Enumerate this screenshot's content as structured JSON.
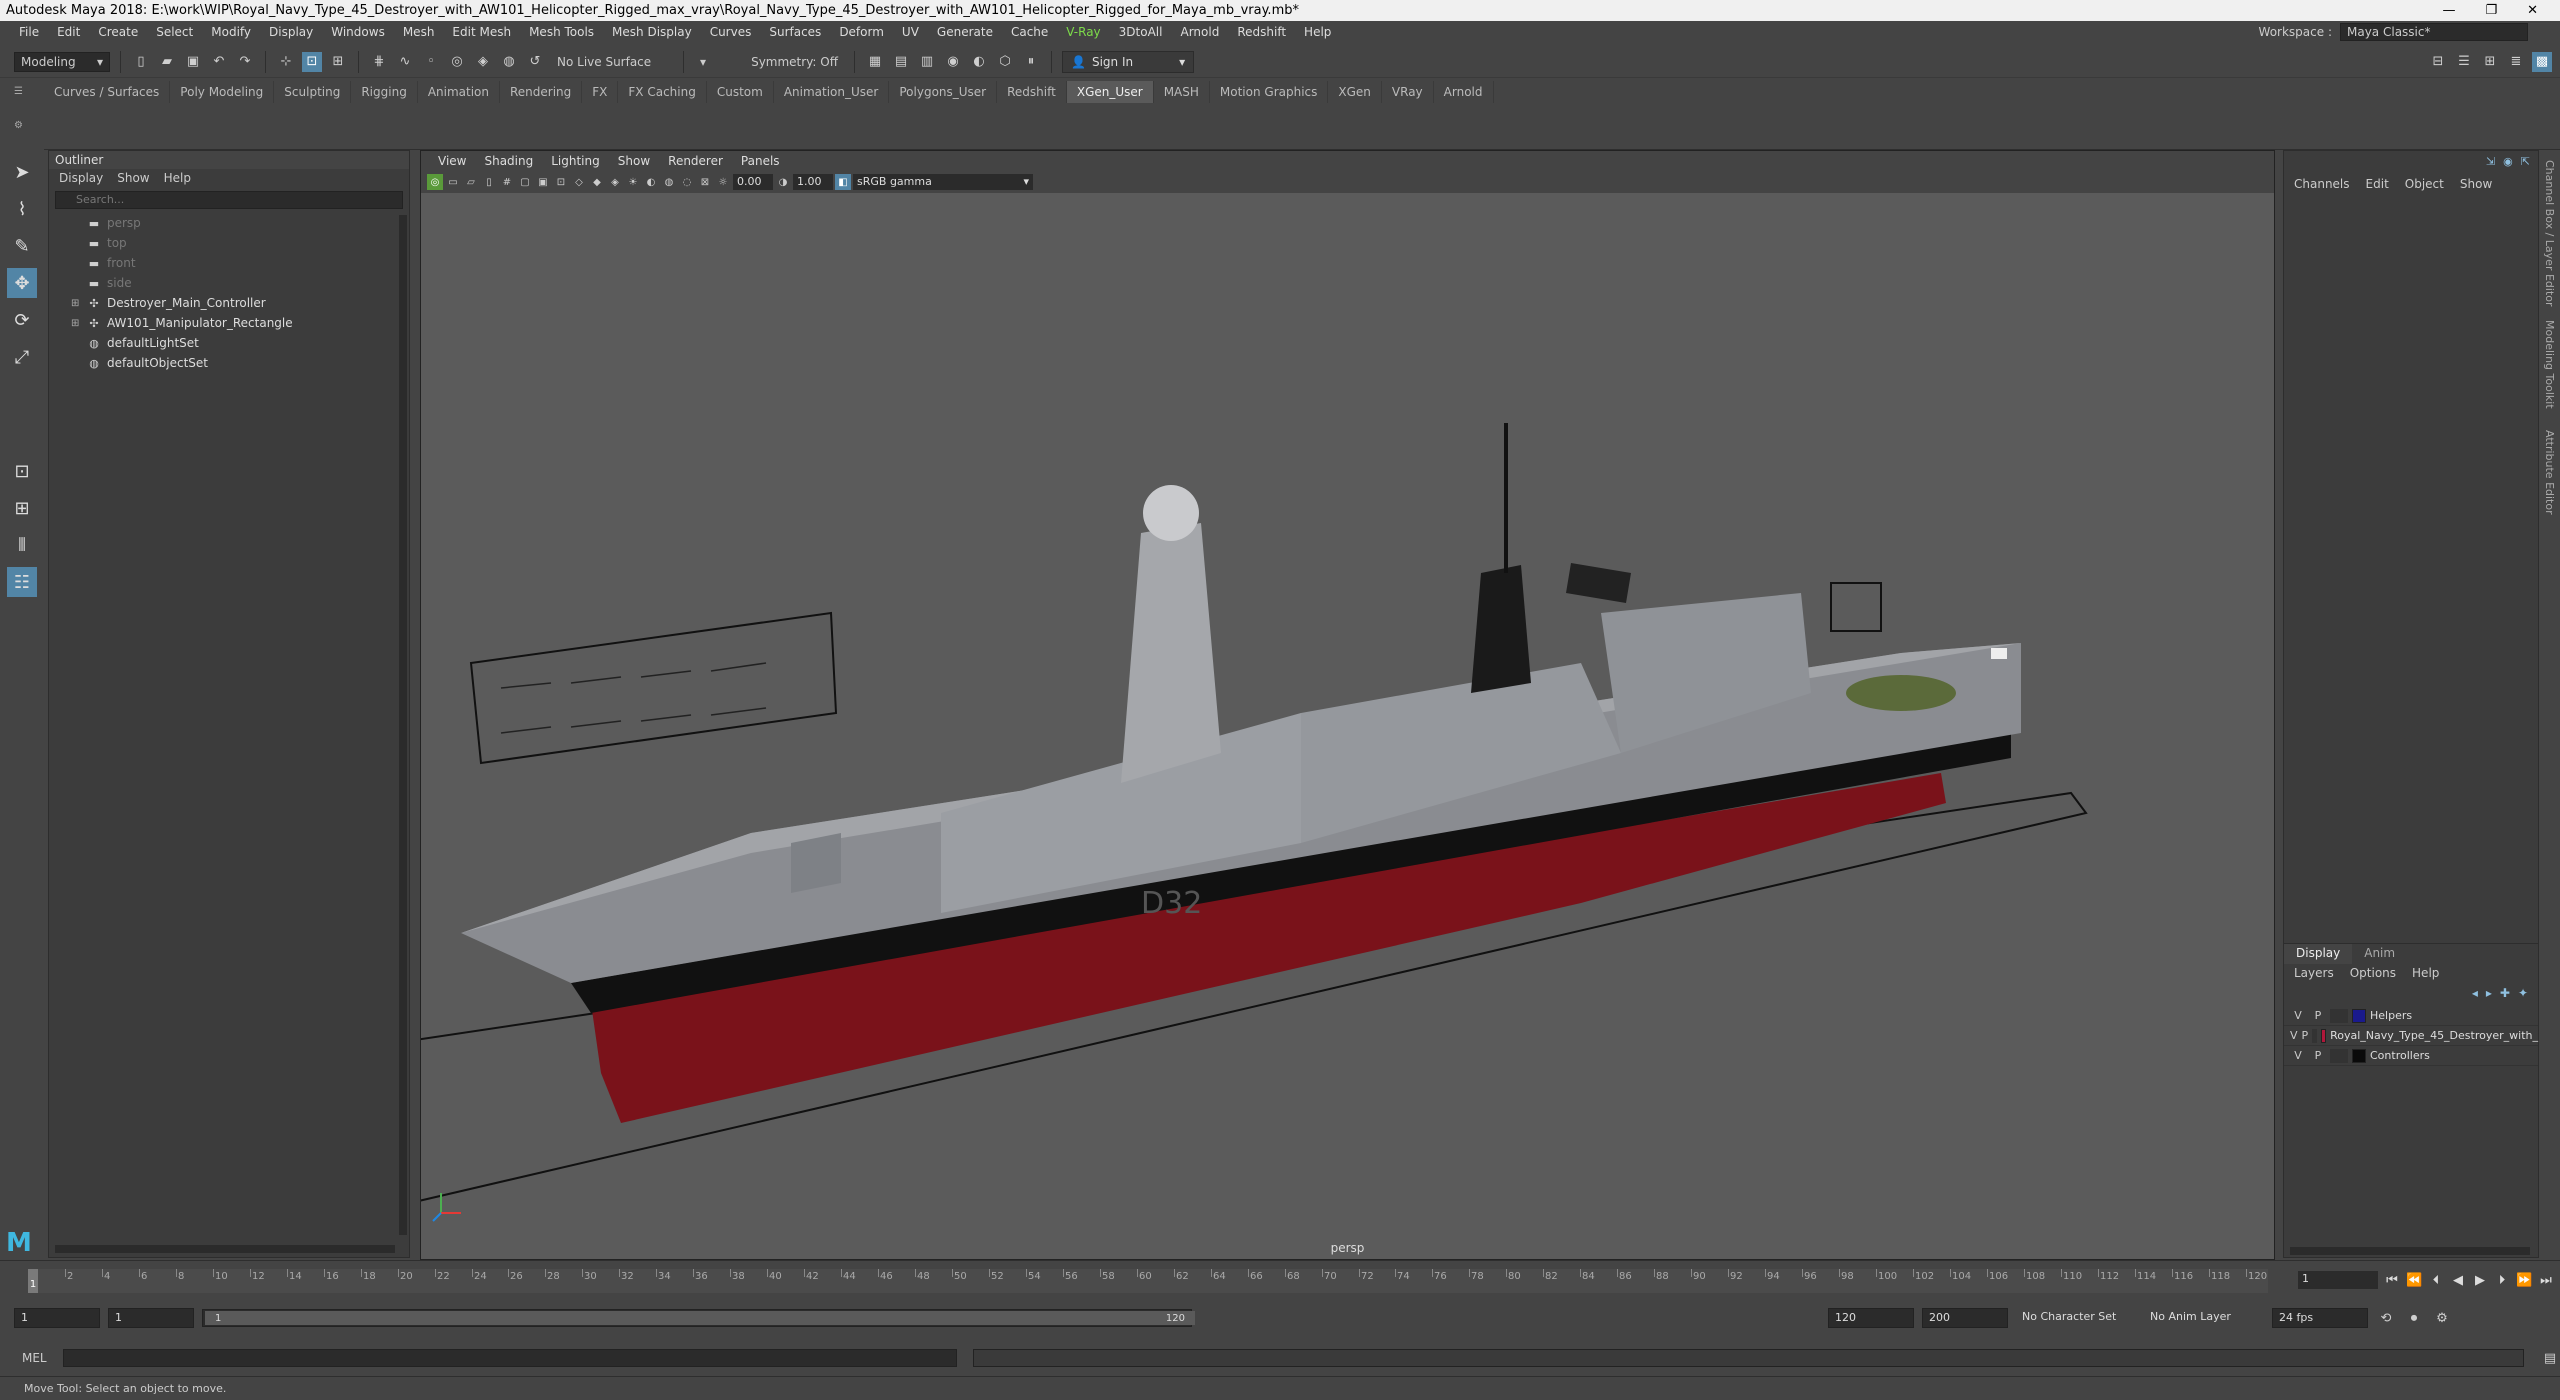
{
  "window": {
    "title": "Autodesk Maya 2018: E:\\work\\WIP\\Royal_Navy_Type_45_Destroyer_with_AW101_Helicopter_Rigged_max_vray\\Royal_Navy_Type_45_Destroyer_with_AW101_Helicopter_Rigged_for_Maya_mb_vray.mb*"
  },
  "menus": [
    "File",
    "Edit",
    "Create",
    "Select",
    "Modify",
    "Display",
    "Windows",
    "Mesh",
    "Edit Mesh",
    "Mesh Tools",
    "Mesh Display",
    "Curves",
    "Surfaces",
    "Deform",
    "UV",
    "Generate",
    "Cache",
    "V-Ray",
    "3DtoAll",
    "Arnold",
    "Redshift",
    "Help"
  ],
  "workspace": {
    "label": "Workspace :",
    "value": "Maya Classic*"
  },
  "status": {
    "mode": "Modeling",
    "live_surface": "No Live Surface",
    "symmetry": "Symmetry: Off",
    "signin": "Sign In"
  },
  "shelf_tabs": [
    "Curves / Surfaces",
    "Poly Modeling",
    "Sculpting",
    "Rigging",
    "Animation",
    "Rendering",
    "FX",
    "FX Caching",
    "Custom",
    "Animation_User",
    "Polygons_User",
    "Redshift",
    "XGen_User",
    "MASH",
    "Motion Graphics",
    "XGen",
    "VRay",
    "Arnold"
  ],
  "shelf_active": "XGen_User",
  "outliner": {
    "title": "Outliner",
    "menu": [
      "Display",
      "Show",
      "Help"
    ],
    "search_placeholder": "Search...",
    "items": [
      {
        "label": "persp",
        "dim": true,
        "expand": false
      },
      {
        "label": "top",
        "dim": true,
        "expand": false
      },
      {
        "label": "front",
        "dim": true,
        "expand": false
      },
      {
        "label": "side",
        "dim": true,
        "expand": false
      },
      {
        "label": "Destroyer_Main_Controller",
        "dim": false,
        "expand": true
      },
      {
        "label": "AW101_Manipulator_Rectangle",
        "dim": false,
        "expand": true
      },
      {
        "label": "defaultLightSet",
        "dim": false,
        "expand": false
      },
      {
        "label": "defaultObjectSet",
        "dim": false,
        "expand": false
      }
    ]
  },
  "viewport": {
    "menu": [
      "View",
      "Shading",
      "Lighting",
      "Show",
      "Renderer",
      "Panels"
    ],
    "exposure": "0.00",
    "gamma_value": "1.00",
    "color_space": "sRGB gamma",
    "camera": "persp",
    "hull_number": "D32"
  },
  "channelbox": {
    "menu": [
      "Channels",
      "Edit",
      "Object",
      "Show"
    ]
  },
  "layers": {
    "tabs": [
      "Display",
      "Anim"
    ],
    "menu": [
      "Layers",
      "Options",
      "Help"
    ],
    "rows": [
      {
        "v": "V",
        "p": "P",
        "color": "#1a1a8c",
        "name": "Helpers"
      },
      {
        "v": "V",
        "p": "P",
        "color": "#b0173a",
        "name": "Royal_Navy_Type_45_Destroyer_with_"
      },
      {
        "v": "V",
        "p": "P",
        "color": "#0a0a0a",
        "name": "Controllers"
      }
    ]
  },
  "side_tabs": [
    "Channel Box / Layer Editor",
    "Modeling Toolkit",
    "Attribute Editor"
  ],
  "timeline": {
    "ticks": [
      "2",
      "4",
      "6",
      "8",
      "10",
      "12",
      "14",
      "16",
      "18",
      "20",
      "22",
      "24",
      "26",
      "28",
      "30",
      "32",
      "34",
      "36",
      "38",
      "40",
      "42",
      "44",
      "46",
      "48",
      "50",
      "52",
      "54",
      "56",
      "58",
      "60",
      "62",
      "64",
      "66",
      "68",
      "70",
      "72",
      "74",
      "76",
      "78",
      "80",
      "82",
      "84",
      "86",
      "88",
      "90",
      "92",
      "94",
      "96",
      "98",
      "100",
      "102",
      "104",
      "106",
      "108",
      "110",
      "112",
      "114",
      "116",
      "118",
      "120"
    ],
    "current": "1",
    "frame_field": "1"
  },
  "range": {
    "start": "1",
    "start2": "1",
    "slider_start": "1",
    "slider_end": "120",
    "end": "120",
    "end2": "200",
    "char_set": "No Character Set",
    "anim_layer": "No Anim Layer",
    "fps": "24 fps"
  },
  "cmd": {
    "label": "MEL"
  },
  "help": "Move Tool: Select an object to move."
}
